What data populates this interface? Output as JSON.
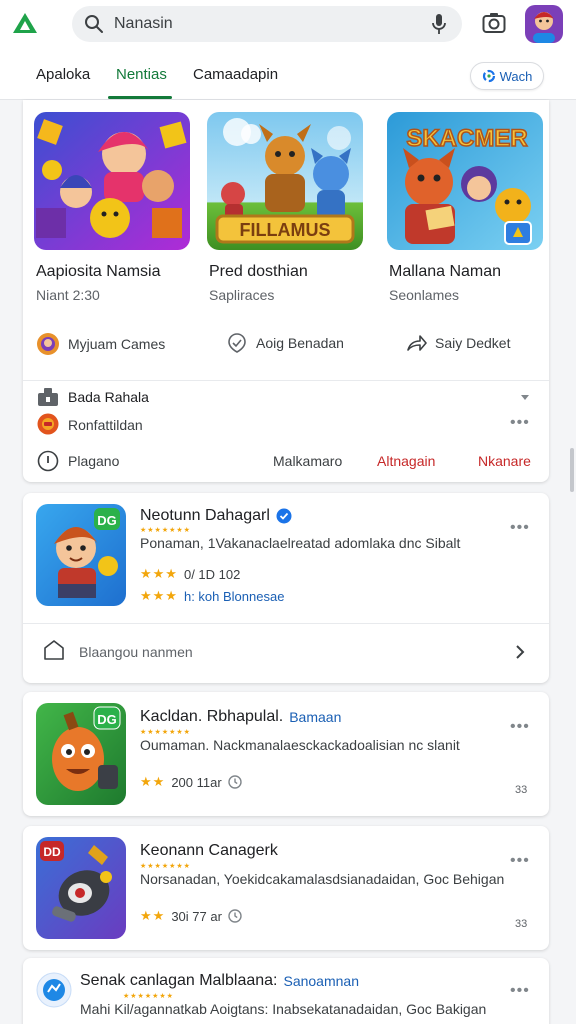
{
  "search": {
    "text": "Nanasin"
  },
  "tabs": [
    {
      "label": "Apaloka"
    },
    {
      "label": "Nentias"
    },
    {
      "label": "Camaadapin"
    }
  ],
  "filter_pill": {
    "label": "Wach"
  },
  "feature": {
    "items": [
      {
        "title": "Aapiosita Namsia",
        "subtitle": "Niant 2:30"
      },
      {
        "title": "Pred dosthian",
        "subtitle": "Sapliraces",
        "art_text": "FILLAMUS"
      },
      {
        "title": "Mallana Naman",
        "subtitle": "Seonlames",
        "art_text": "SKACMER"
      }
    ],
    "actions": [
      {
        "label": "Myjuam Cames"
      },
      {
        "label": "Aoig Benadan"
      },
      {
        "label": "Saiy Dedket"
      }
    ],
    "section_title": "Bada Rahala",
    "row2_label": "Ronfattildan",
    "row3_label": "Plagano",
    "row3_links": [
      {
        "label": "Malkamaro"
      },
      {
        "label": "Altnagain"
      },
      {
        "label": "Nkanare"
      }
    ]
  },
  "apps": [
    {
      "title": "Neotunn Dahagarl",
      "desc": "Ponaman, 1Vakanaclaelreatad adomlaka dnc Sibalt",
      "rating_text": "0/ 1D 102",
      "link_text": "h: koh Blonnesae",
      "footer": "Blaangou nanmen"
    },
    {
      "title": "Kacldan. Rbhapulal.",
      "title_link": "Bamaan",
      "desc": "Oumaman. Nackmanalaesckackadoalisian nc slanit",
      "rating_text": "200 11ar",
      "corner": "33"
    },
    {
      "title": "Keonann Canagerk",
      "desc": "Norsanadan, Yoekidcakamalasdsianadaidan, Goc Behigan",
      "rating_text": "30i 77 ar",
      "corner": "33"
    },
    {
      "title": "Senak canlagan Malblaana:",
      "title_link": "Sanoamnan",
      "desc": "Mahi Kil/agannatkab Aoigtans: Inabsekatanadaidan, Goc Bakigan"
    }
  ],
  "colors": {
    "accent_green": "#137a3a",
    "link_blue": "#1a5fb4",
    "alert_red": "#c62828",
    "star": "#f2a60c"
  }
}
